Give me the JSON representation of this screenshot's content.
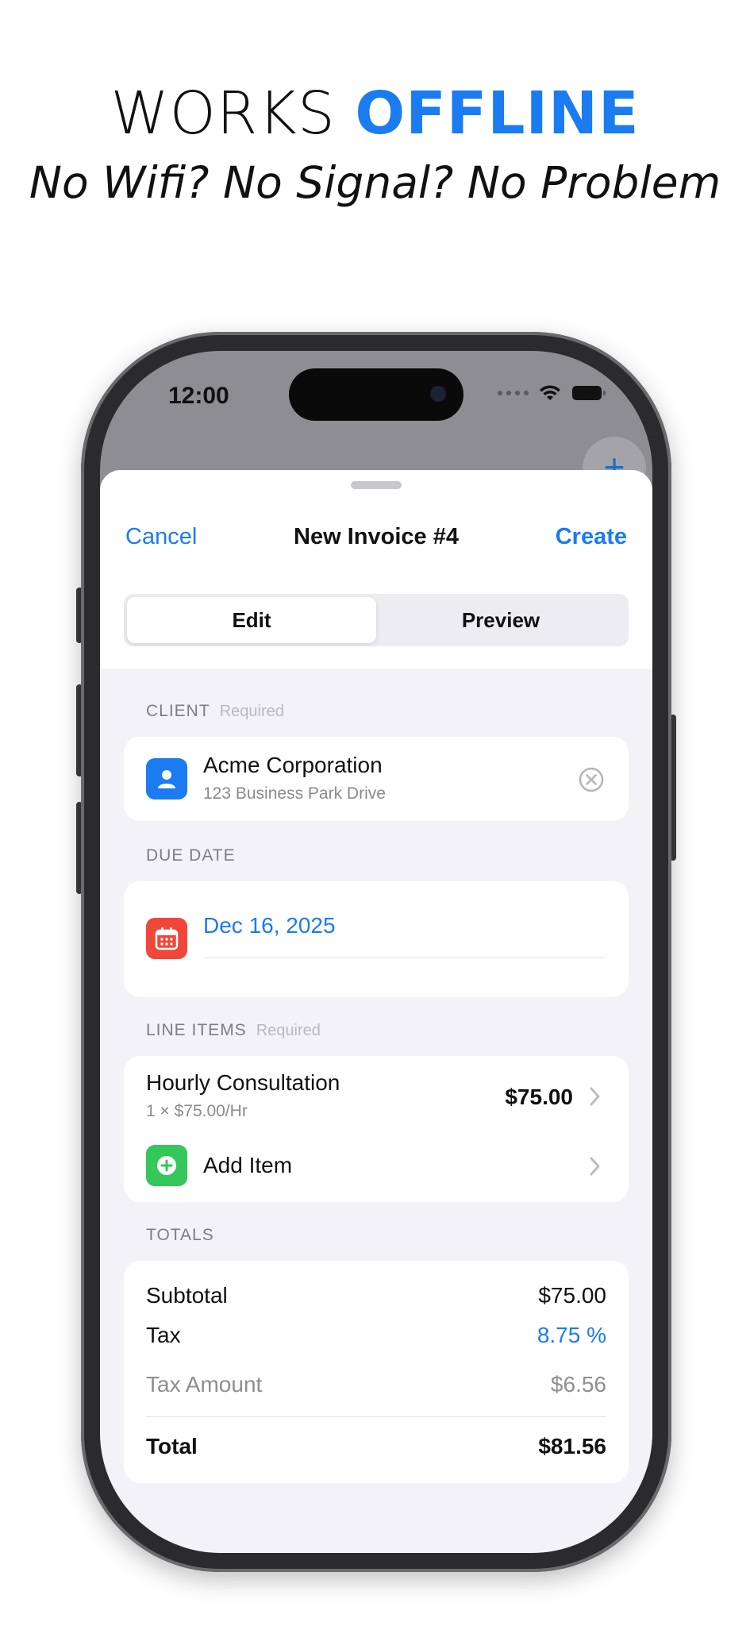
{
  "promo": {
    "headline_plain": "WORKS",
    "headline_accent": "OFFLINE",
    "subhead": "No Wifi? No Signal? No Problem"
  },
  "status_bar": {
    "time": "12:00"
  },
  "background": {
    "add_symbol": "+"
  },
  "nav": {
    "cancel_label": "Cancel",
    "title": "New Invoice #4",
    "create_label": "Create"
  },
  "segments": [
    {
      "label": "Edit",
      "active": true
    },
    {
      "label": "Preview",
      "active": false
    }
  ],
  "client": {
    "section_label": "CLIENT",
    "required_label": "Required",
    "name": "Acme Corporation",
    "address": "123 Business Park Drive"
  },
  "due_date": {
    "section_label": "DUE DATE",
    "value": "Dec 16, 2025"
  },
  "line_items": {
    "section_label": "LINE ITEMS",
    "required_label": "Required",
    "items": [
      {
        "title": "Hourly Consultation",
        "detail": "1 × $75.00/Hr",
        "amount": "$75.00"
      }
    ],
    "add_label": "Add Item"
  },
  "totals": {
    "section_label": "TOTALS",
    "subtotal_label": "Subtotal",
    "subtotal_value": "$75.00",
    "tax_label": "Tax",
    "tax_value": "8.75 %",
    "tax_amount_label": "Tax Amount",
    "tax_amount_value": "$6.56",
    "total_label": "Total",
    "total_value": "$81.56"
  },
  "colors": {
    "accent": "#1a7cf0",
    "client_icon_bg": "#1a7cf0",
    "calendar_icon_bg": "#f0473a",
    "add_icon_bg": "#34c759"
  },
  "icons": {
    "client": "person-icon",
    "due_date": "calendar-icon",
    "add_item": "plus-circle-icon",
    "clear": "clear-circle-icon",
    "disclosure": "chevron-right-icon"
  }
}
